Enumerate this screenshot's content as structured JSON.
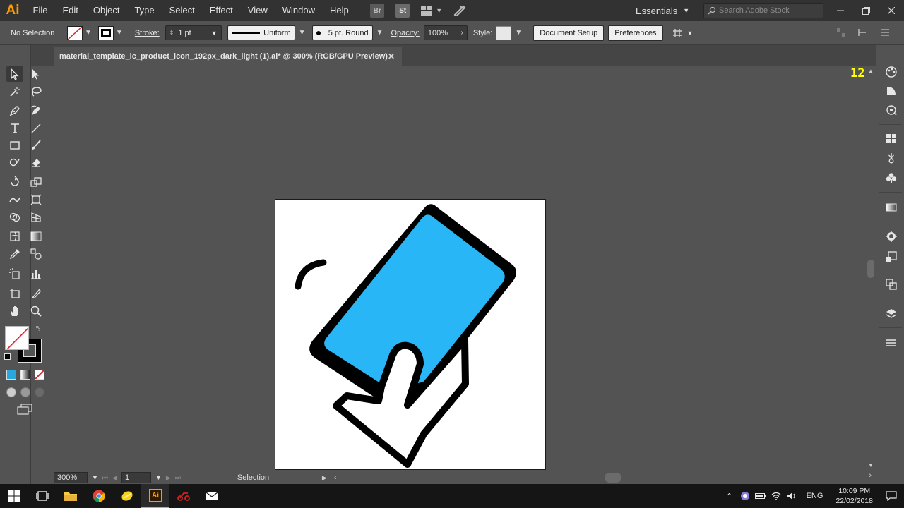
{
  "app": {
    "logo_text": "Ai",
    "accent_color": "#ff9a00"
  },
  "menu": {
    "items": [
      "File",
      "Edit",
      "Object",
      "Type",
      "Select",
      "Effect",
      "View",
      "Window",
      "Help"
    ]
  },
  "app_switcher": {
    "bridge": "Br",
    "stock": "St"
  },
  "workspace": {
    "label": "Essentials"
  },
  "stock_search": {
    "placeholder": "Search Adobe Stock"
  },
  "control_bar": {
    "selection_status": "No Selection",
    "stroke_label": "Stroke:",
    "stroke_weight": "1 pt",
    "profile": "Uniform",
    "brush": "5 pt. Round",
    "opacity_label": "Opacity:",
    "opacity_value": "100%",
    "style_label": "Style:",
    "document_setup": "Document Setup",
    "preferences": "Preferences"
  },
  "document": {
    "tab_title": "material_template_ic_product_icon_192px_dark_light (1).ai* @ 300% (RGB/GPU Preview)",
    "corner_readout": "12"
  },
  "artwork": {
    "phone_screen_color": "#29b6f6",
    "outline_color": "#000000",
    "artboard_color": "#ffffff"
  },
  "status_bar": {
    "zoom": "300%",
    "artboard_number": "1",
    "current_tool": "Selection"
  },
  "taskbar": {
    "language": "ENG",
    "time": "10:09 PM",
    "date": "22/02/2018"
  },
  "colors": {
    "ui_dark": "#323232",
    "ui_mid": "#535353",
    "ui_panel": "#454545"
  }
}
